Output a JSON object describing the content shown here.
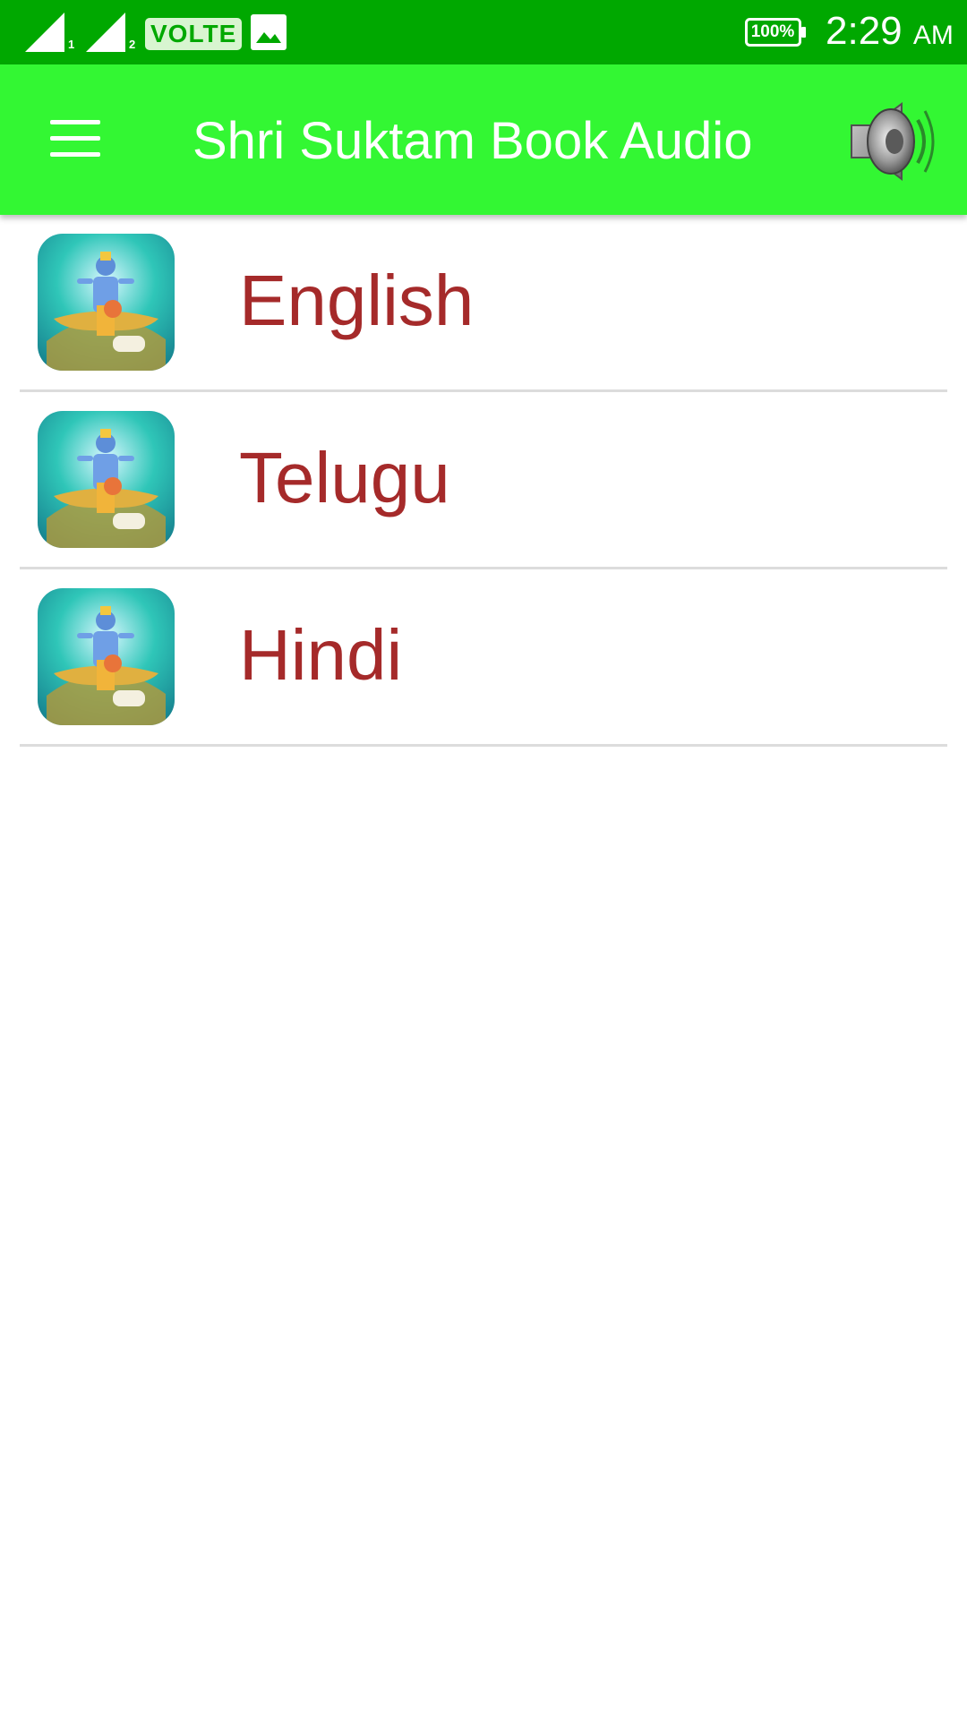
{
  "status_bar": {
    "sim1_label": "1",
    "sim2_label": "2",
    "volte": "VOLTE",
    "battery": "100%",
    "time": "2:29",
    "ampm": "AM",
    "icons": [
      "signal-sim1-icon",
      "signal-sim2-icon",
      "volte-badge",
      "gallery-icon",
      "battery-icon"
    ],
    "color": "#00a800"
  },
  "app_bar": {
    "title": "Shri Suktam Book Audio",
    "menu_icon": "hamburger-menu-icon",
    "speaker_icon": "speaker-icon",
    "color": "#33f733"
  },
  "list": {
    "label_color": "#a52a2a",
    "items": [
      {
        "label": "English",
        "icon": "deity-thumbnail-icon"
      },
      {
        "label": "Telugu",
        "icon": "deity-thumbnail-icon"
      },
      {
        "label": "Hindi",
        "icon": "deity-thumbnail-icon"
      }
    ]
  }
}
